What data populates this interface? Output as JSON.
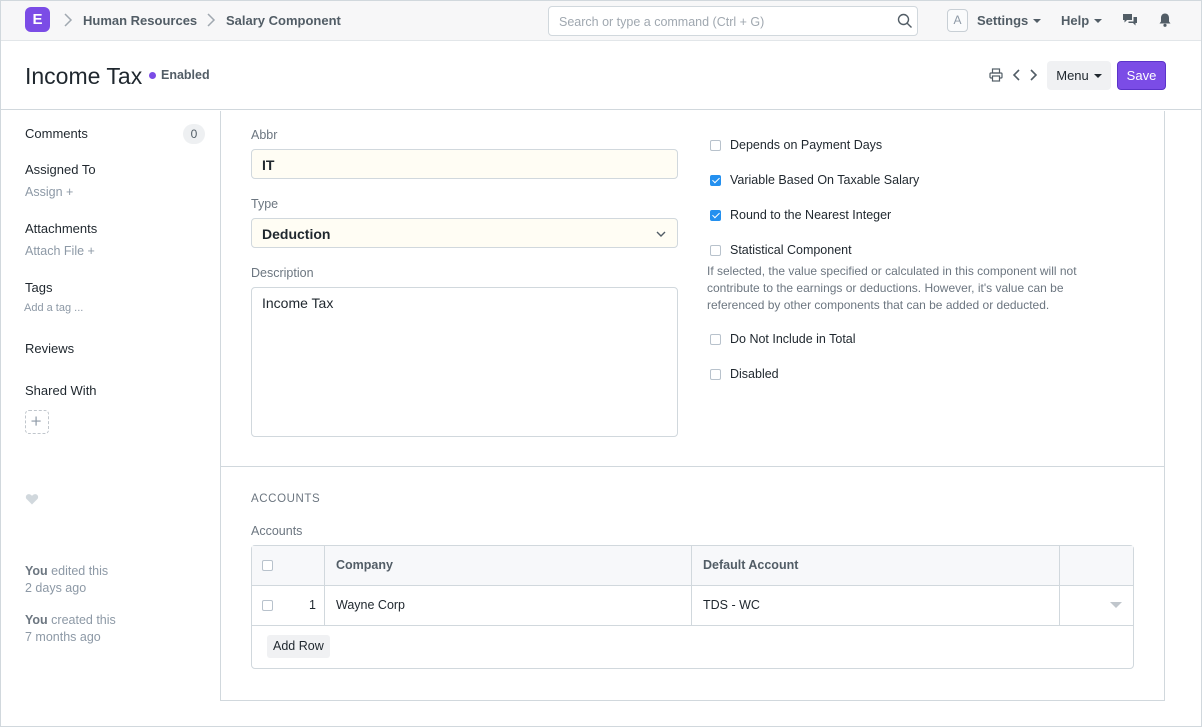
{
  "navbar": {
    "logo_letter": "E",
    "breadcrumbs": [
      "Human Resources",
      "Salary Component"
    ],
    "search_placeholder": "Search or type a command (Ctrl + G)",
    "avatar_letter": "A",
    "settings_label": "Settings",
    "help_label": "Help",
    "icons": [
      "chat-icon",
      "bell-icon"
    ]
  },
  "page": {
    "title": "Income Tax",
    "status": "Enabled",
    "status_color": "#7b4ce6",
    "menu_label": "Menu",
    "save_label": "Save",
    "accent_color": "#7b4ce6"
  },
  "sidebar": {
    "comments_label": "Comments",
    "comments_count": "0",
    "assigned_label": "Assigned To",
    "assign_action": "Assign +",
    "attachments_label": "Attachments",
    "attach_action": "Attach File +",
    "tags_label": "Tags",
    "tags_action": "Add a tag ...",
    "reviews_label": "Reviews",
    "shared_label": "Shared With",
    "activity": [
      {
        "who": "You",
        "action": " edited this",
        "when": "2 days ago"
      },
      {
        "who": "You",
        "action": " created this",
        "when": "7 months ago"
      }
    ]
  },
  "form": {
    "abbr_label": "Abbr",
    "abbr_value": "IT",
    "type_label": "Type",
    "type_value": "Deduction",
    "description_label": "Description",
    "description_value": "Income Tax",
    "checkboxes": [
      {
        "label": "Depends on Payment Days",
        "checked": false
      },
      {
        "label": "Variable Based On Taxable Salary",
        "checked": true
      },
      {
        "label": "Round to the Nearest Integer",
        "checked": true
      },
      {
        "label": "Statistical Component",
        "checked": false
      },
      {
        "label": "Do Not Include in Total",
        "checked": false
      },
      {
        "label": "Disabled",
        "checked": false
      }
    ],
    "statistical_help": "If selected, the value specified or calculated in this component will not contribute to the earnings or deductions. However, it's value can be referenced by other components that can be added or deducted."
  },
  "accounts": {
    "section_title": "ACCOUNTS",
    "table_label": "Accounts",
    "columns": [
      "Company",
      "Default Account"
    ],
    "rows": [
      {
        "idx": "1",
        "company": "Wayne Corp",
        "default_account": "TDS - WC"
      }
    ],
    "add_row_label": "Add Row"
  }
}
